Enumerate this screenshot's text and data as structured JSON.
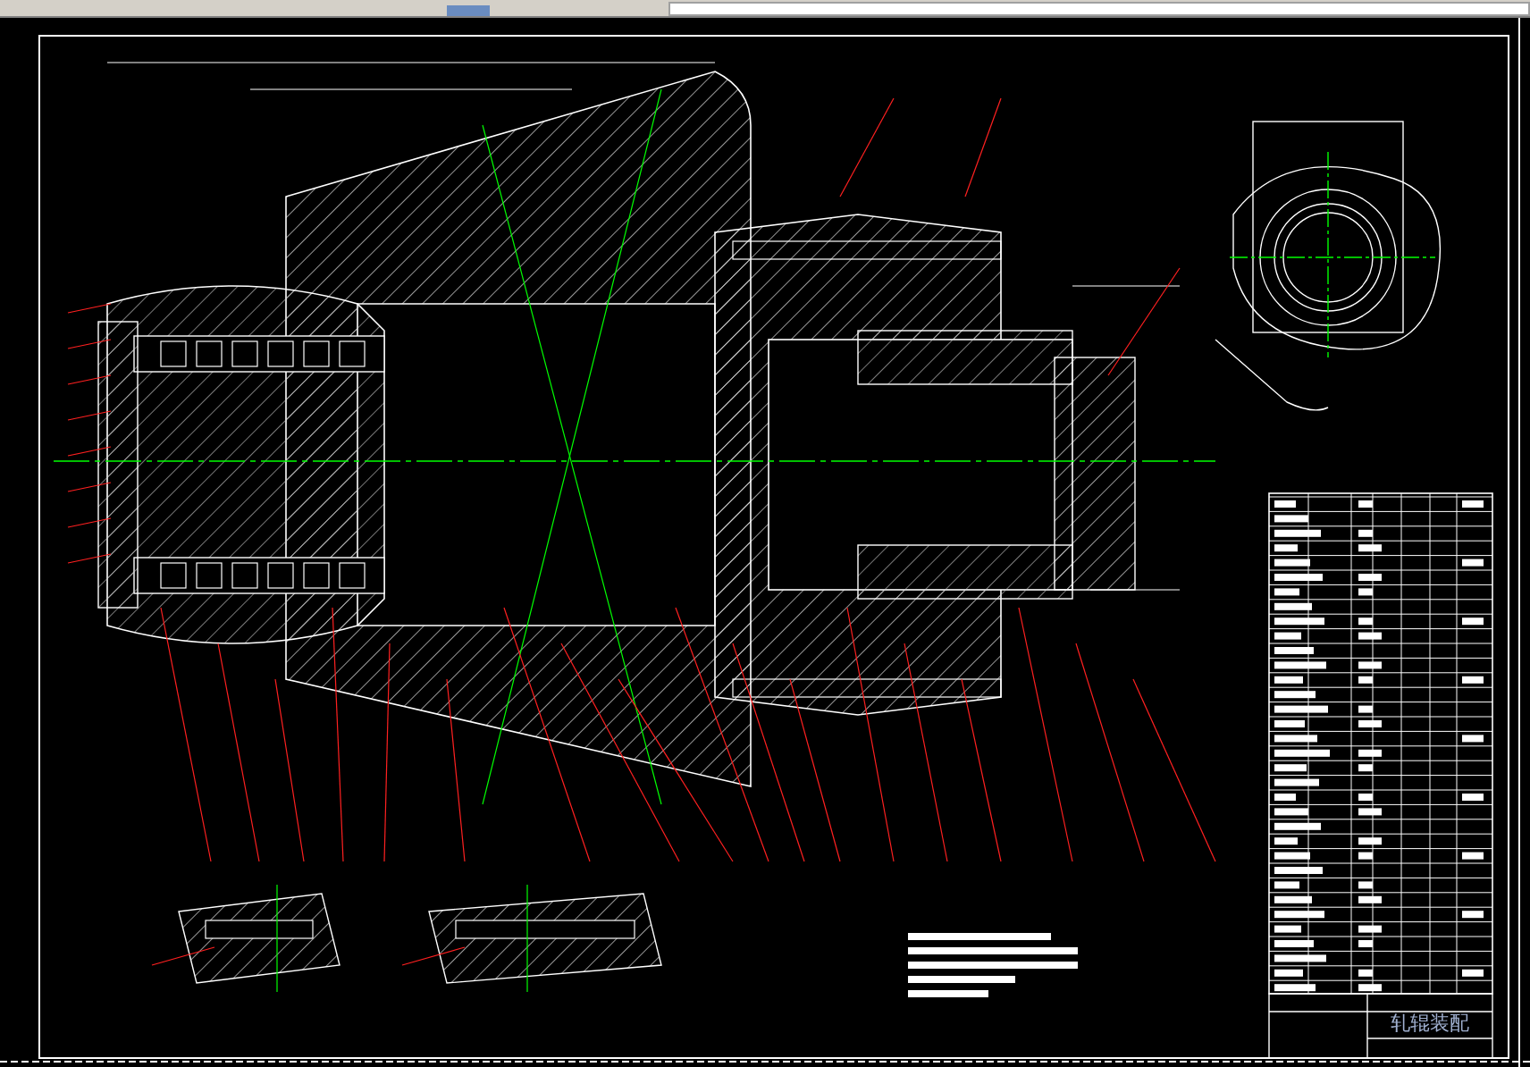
{
  "drawing": {
    "title_block": {
      "title": "轧辊装配"
    }
  }
}
